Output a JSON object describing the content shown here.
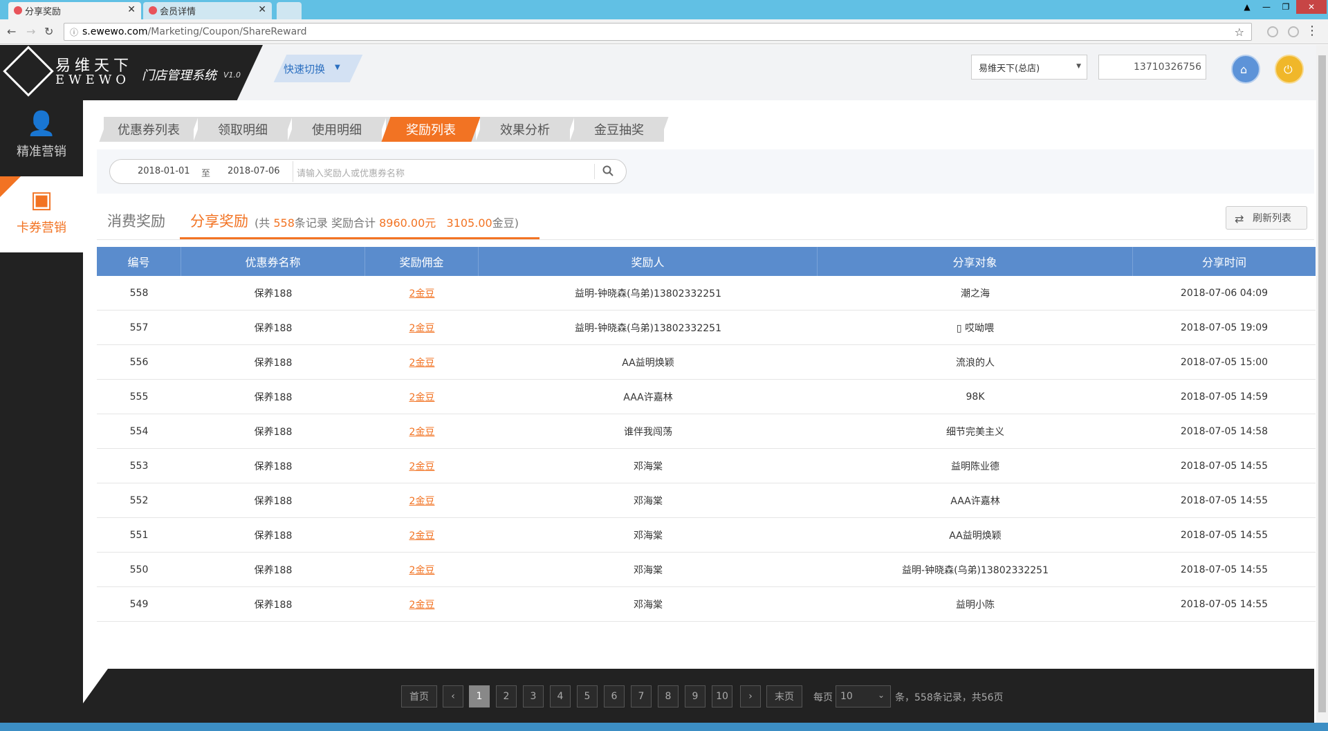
{
  "browser": {
    "tabs": [
      {
        "label": "分享奖励"
      },
      {
        "label": "会员详情"
      }
    ],
    "url_host": "s.ewewo.com",
    "url_path": "/Marketing/Coupon/ShareReward"
  },
  "header": {
    "logo_cn": "易维天下",
    "logo_en": "EWEWO",
    "system_name": "门店管理系统",
    "system_version": "V1.0",
    "quick_switch": "快速切换",
    "store": "易维天下(总店)",
    "phone": "13710326756"
  },
  "sidebar": {
    "items": [
      {
        "label": "精准营销",
        "icon": "user-icon"
      },
      {
        "label": "卡券营销",
        "icon": "coupon-icon"
      }
    ]
  },
  "content_tabs": [
    {
      "label": "优惠券列表"
    },
    {
      "label": "领取明细"
    },
    {
      "label": "使用明细"
    },
    {
      "label": "奖励列表"
    },
    {
      "label": "效果分析"
    },
    {
      "label": "金豆抽奖"
    }
  ],
  "filter": {
    "date_from": "2018-01-01",
    "date_sep": "至",
    "date_to": "2018-07-06",
    "search_placeholder": "请输入奖励人或优惠券名称"
  },
  "subtabs": {
    "consume": "消费奖励",
    "share": "分享奖励",
    "meta_open": "(共",
    "count": "558",
    "meta_records": "条记录  奖励合计",
    "total_money": "8960.00元",
    "total_beans": "3105.00",
    "meta_close": "金豆)"
  },
  "refresh_label": "刷新列表",
  "table": {
    "headers": [
      "编号",
      "优惠券名称",
      "奖励佣金",
      "奖励人",
      "分享对象",
      "分享时间"
    ],
    "rows": [
      {
        "id": "558",
        "coupon": "保养188",
        "reward": "2金豆",
        "rewarder": "益明-钟晓森(乌弟)13802332251",
        "target": "潮之海",
        "time": "2018-07-06 04:09"
      },
      {
        "id": "557",
        "coupon": "保养188",
        "reward": "2金豆",
        "rewarder": "益明-钟晓森(乌弟)13802332251",
        "target": "▯ 哎呦喂",
        "time": "2018-07-05 19:09"
      },
      {
        "id": "556",
        "coupon": "保养188",
        "reward": "2金豆",
        "rewarder": "AA益明焕颖",
        "target": "流浪的人",
        "time": "2018-07-05 15:00"
      },
      {
        "id": "555",
        "coupon": "保养188",
        "reward": "2金豆",
        "rewarder": "AAA许嘉林",
        "target": "98K",
        "time": "2018-07-05 14:59"
      },
      {
        "id": "554",
        "coupon": "保养188",
        "reward": "2金豆",
        "rewarder": "谁伴我闯荡",
        "target": "细节完美主义",
        "time": "2018-07-05 14:58"
      },
      {
        "id": "553",
        "coupon": "保养188",
        "reward": "2金豆",
        "rewarder": "邓海棠",
        "target": "益明陈业德",
        "time": "2018-07-05 14:55"
      },
      {
        "id": "552",
        "coupon": "保养188",
        "reward": "2金豆",
        "rewarder": "邓海棠",
        "target": "AAA许嘉林",
        "time": "2018-07-05 14:55"
      },
      {
        "id": "551",
        "coupon": "保养188",
        "reward": "2金豆",
        "rewarder": "邓海棠",
        "target": "AA益明焕颖",
        "time": "2018-07-05 14:55"
      },
      {
        "id": "550",
        "coupon": "保养188",
        "reward": "2金豆",
        "rewarder": "邓海棠",
        "target": "益明-钟晓森(乌弟)13802332251",
        "time": "2018-07-05 14:55"
      },
      {
        "id": "549",
        "coupon": "保养188",
        "reward": "2金豆",
        "rewarder": "邓海棠",
        "target": "益明小陈",
        "time": "2018-07-05 14:55"
      }
    ]
  },
  "pagination": {
    "first": "首页",
    "prev": "‹",
    "pages": [
      "1",
      "2",
      "3",
      "4",
      "5",
      "6",
      "7",
      "8",
      "9",
      "10"
    ],
    "current": "1",
    "next": "›",
    "last": "末页",
    "per_page_label": "每页",
    "per_page_value": "10",
    "summary": "条，558条记录，共56页"
  },
  "colors": {
    "accent": "#f27323",
    "table_header": "#5a8ccd",
    "dark": "#222222"
  }
}
